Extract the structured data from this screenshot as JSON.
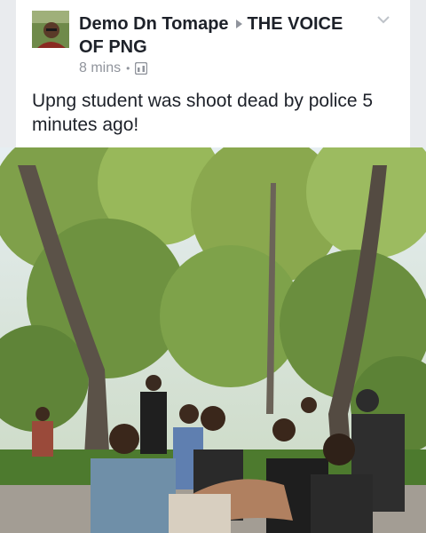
{
  "post": {
    "author": "Demo Dn Tomape",
    "group": "THE VOICE OF PNG",
    "time": "8 mins",
    "separator": "•",
    "text": "Upng student was shoot dead by police 5 minutes ago!",
    "icons": {
      "avatar": "profile-avatar",
      "arrow": "triangle-right-icon",
      "options": "chevron-down-icon",
      "audience": "group-audience-icon"
    }
  },
  "photo": {
    "subject": "outdoor photo under trees"
  },
  "colors": {
    "background": "#e9ebee",
    "card": "#ffffff",
    "text": "#1d2129",
    "meta": "#90949c"
  }
}
